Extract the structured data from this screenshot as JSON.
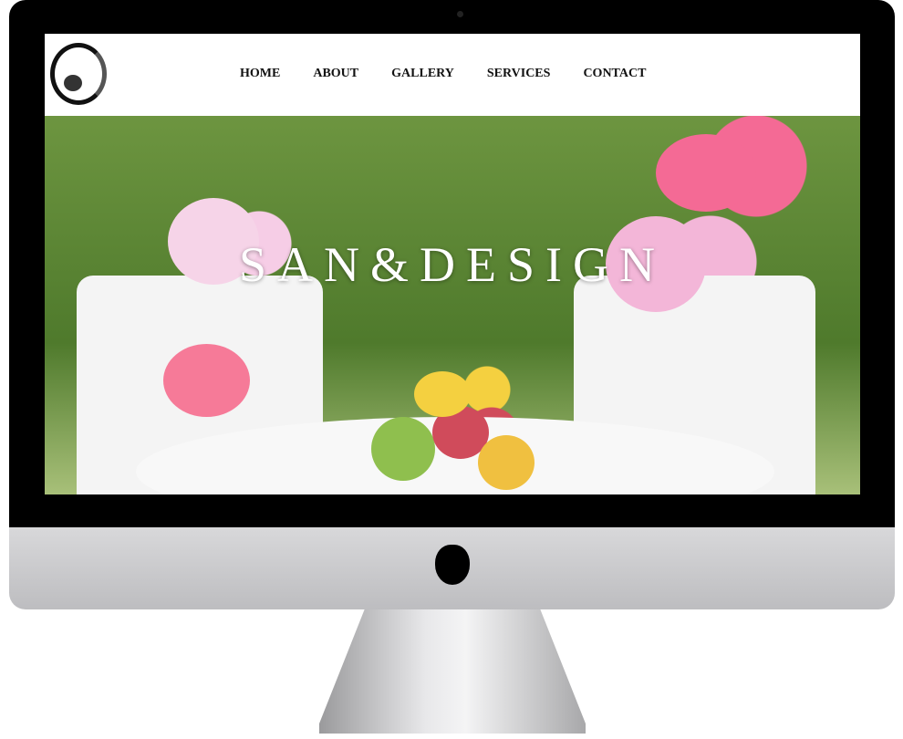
{
  "site": {
    "title": "SAN&DESIGN"
  },
  "nav": {
    "items": [
      {
        "label": "HOME"
      },
      {
        "label": "ABOUT"
      },
      {
        "label": "GALLERY"
      },
      {
        "label": "SERVICES"
      },
      {
        "label": "CONTACT"
      }
    ]
  },
  "colors": {
    "bezel": "#000000",
    "chin": "#c8c8ca",
    "hedge": "#5e8a36",
    "text": "#111111"
  }
}
